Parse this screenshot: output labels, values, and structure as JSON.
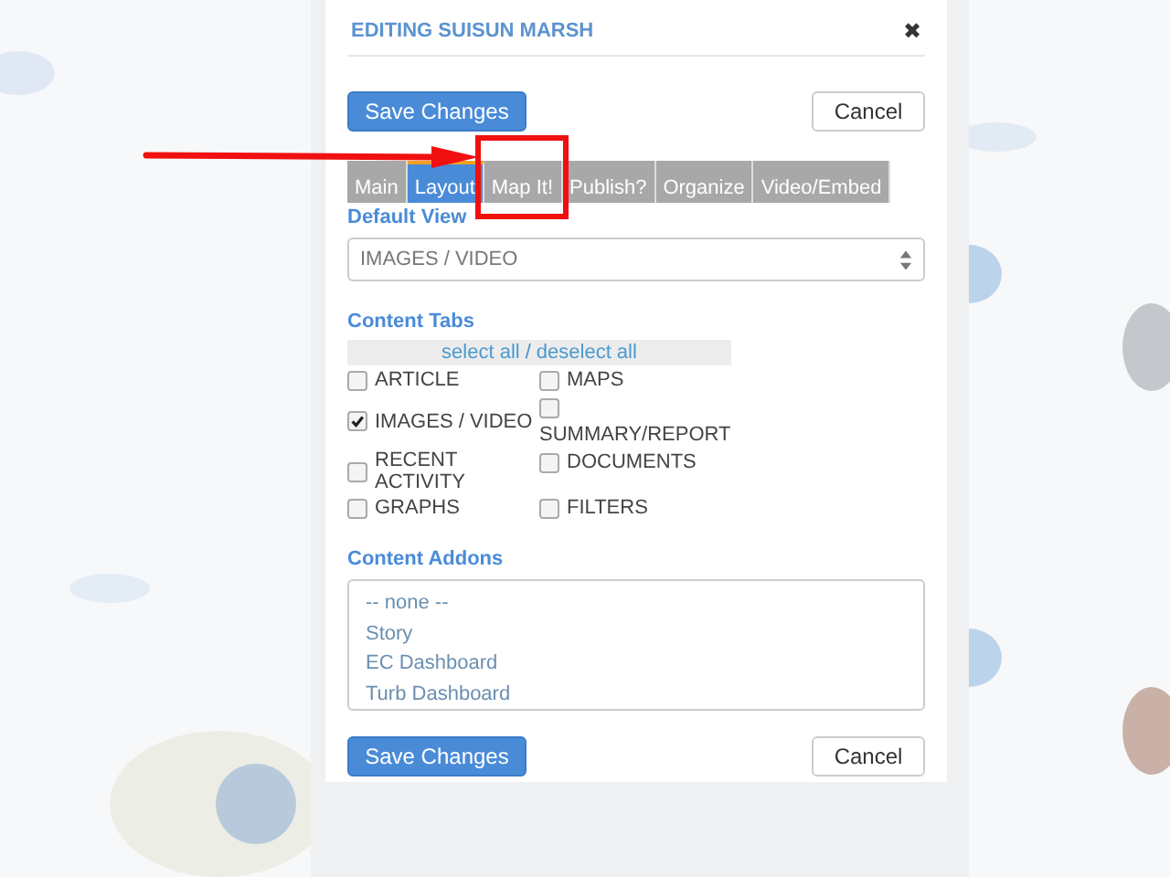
{
  "dialog": {
    "title": "EDITING SUISUN MARSH",
    "close": "✖",
    "top_buttons": [
      {
        "label": "Save Changes",
        "kind": "primary"
      },
      {
        "label": "Cancel",
        "kind": "secondary"
      }
    ],
    "tabs": [
      {
        "label": "Main",
        "selected": false
      },
      {
        "label": "Layout",
        "selected": true
      },
      {
        "label": "Map It!",
        "selected": false
      },
      {
        "label": "Publish?",
        "selected": false
      },
      {
        "label": "Organize",
        "selected": false
      },
      {
        "label": "Video/Embed",
        "selected": false
      }
    ],
    "default_view": {
      "label": "Default View",
      "value": "IMAGES / VIDEO"
    },
    "content_tabs": {
      "label": "Content Tabs",
      "select_all": "select all",
      "separator": "/",
      "deselect_all": "deselect all",
      "options": [
        {
          "label": "ARTICLE",
          "checked": false
        },
        {
          "label": "MAPS",
          "checked": false
        },
        {
          "label": "IMAGES / VIDEO",
          "checked": true
        },
        {
          "label": "SUMMARY/REPORT",
          "checked": false
        },
        {
          "label": "RECENT ACTIVITY",
          "checked": false
        },
        {
          "label": "DOCUMENTS",
          "checked": false
        },
        {
          "label": "GRAPHS",
          "checked": false
        },
        {
          "label": "FILTERS",
          "checked": false
        }
      ]
    },
    "content_addons": {
      "label": "Content Addons",
      "items": [
        "-- none --",
        "Story",
        "EC Dashboard",
        "Turb Dashboard"
      ]
    },
    "bottom_buttons": [
      {
        "label": "Save Changes",
        "kind": "primary"
      },
      {
        "label": "Cancel",
        "kind": "secondary"
      }
    ]
  }
}
